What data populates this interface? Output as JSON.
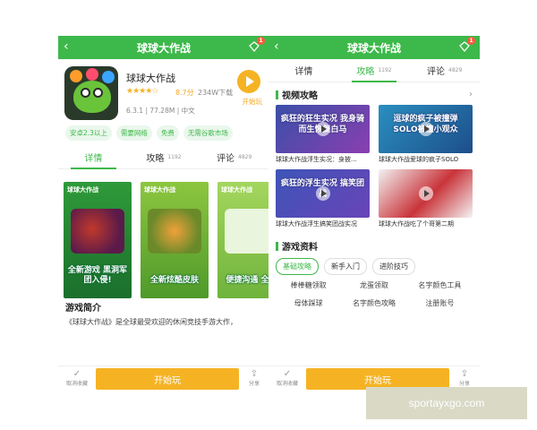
{
  "left": {
    "topbar": {
      "title": "球球大作战",
      "back": "‹",
      "badge": "1"
    },
    "app": {
      "name": "球球大作战",
      "stars": "★★★★☆",
      "score": "8.7分",
      "downloads": "234W下载",
      "meta": "6.3.1 | 77.28M | 中文",
      "start_label": "开始玩"
    },
    "tags": [
      "安卓2.3以上",
      "需要网络",
      "免费",
      "无需谷歌市场"
    ],
    "tabs": [
      {
        "label": "详情",
        "count": ""
      },
      {
        "label": "攻略",
        "count": "1192"
      },
      {
        "label": "评论",
        "count": "4829"
      }
    ],
    "shots": [
      {
        "header": "球球大作战",
        "caption": "全新游戏 黑洞军团入侵!"
      },
      {
        "header": "球球大作战",
        "caption": "全新炫酷皮肤"
      },
      {
        "header": "球球大作战",
        "caption": "便捷沟通 全民"
      }
    ],
    "intro_title": "游戏简介",
    "intro_text": "《球球大作战》是全球最受欢迎的休闲竞技手游大作，"
  },
  "right": {
    "topbar": {
      "title": "球球大作战",
      "back": "‹",
      "badge": "1"
    },
    "tabs": [
      {
        "label": "详情",
        "count": ""
      },
      {
        "label": "攻略",
        "count": "1192"
      },
      {
        "label": "评论",
        "count": "4829"
      }
    ],
    "video_section": "视频攻略",
    "videos": [
      {
        "overlay": "疯狂的狂生实况 我身骑而生恢复白马",
        "caption": "球球大作战浮生实况：身披..."
      },
      {
        "overlay": "逗球的疯子被撞弹 SOLO被撞小观众",
        "caption": "球球大作战爱球的疯子SOLO"
      },
      {
        "overlay": "疯狂的浮生实况 搞笑团战",
        "caption": "球球大作战浮生搞笑团战实况"
      },
      {
        "overlay": "",
        "caption": "球球大作战吃了个哥第二期"
      }
    ],
    "info_section": "游戏资料",
    "pills": [
      "基础攻略",
      "新手入门",
      "进阶技巧"
    ],
    "links": [
      "棒棒糖领取",
      "龙蛋领取",
      "名字颜色工具",
      "母体踩球",
      "名字颜色攻略",
      "注册账号"
    ]
  },
  "bottombar": {
    "fav_label": "取消收藏",
    "start_label": "开始玩",
    "share_label": "分享",
    "fav_icon": "check-icon",
    "share_icon": "share-icon"
  },
  "watermark": "sportayxgo.com",
  "colors": {
    "brand_green": "#3db84a",
    "accent_yellow": "#f5b324",
    "badge_red": "#ff5a3c"
  }
}
